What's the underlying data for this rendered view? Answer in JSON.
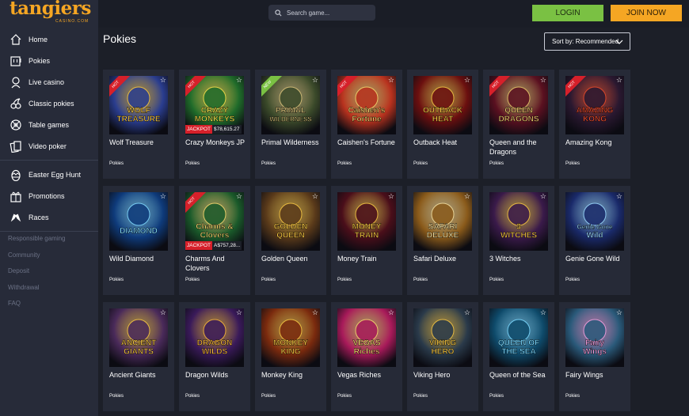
{
  "brand": {
    "logo_text": "tangiers",
    "logo_sub": "CASINO.COM"
  },
  "sidebar": {
    "items": [
      {
        "label": "Home",
        "icon": "home-icon"
      },
      {
        "label": "Pokies",
        "icon": "slot-machine-icon"
      },
      {
        "label": "Live casino",
        "icon": "dealer-icon"
      },
      {
        "label": "Classic pokies",
        "icon": "cherries-icon"
      },
      {
        "label": "Table games",
        "icon": "roulette-icon"
      },
      {
        "label": "Video poker",
        "icon": "cards-icon"
      },
      {
        "label": "Easter Egg Hunt",
        "icon": "egg-icon"
      },
      {
        "label": "Promotions",
        "icon": "gift-icon"
      },
      {
        "label": "Races",
        "icon": "race-flags-icon"
      }
    ],
    "footer": [
      "Responsible gaming",
      "Community",
      "Deposit",
      "Withdrawal",
      "FAQ"
    ]
  },
  "header": {
    "search_placeholder": "Search game...",
    "login": "LOGIN",
    "join": "JOIN NOW"
  },
  "main": {
    "title": "Pokies",
    "sort_label": "Sort by: Recommended"
  },
  "games": [
    {
      "name": "Wolf Treasure",
      "cat": "Pokies",
      "badge": "HOT",
      "art": "WOLF TREASURE",
      "bg": "#2a3d8f",
      "fg": "#f5c542"
    },
    {
      "name": "Crazy Monkeys JP",
      "cat": "Pokies",
      "badge": "HOT",
      "jackpot": "$78,615.27",
      "jp_label": "JACKPOT",
      "art": "CRAZY MONKEYS",
      "bg": "#1f6b2a",
      "fg": "#f5e04a"
    },
    {
      "name": "Primal Wilderness",
      "cat": "Pokies",
      "badge": "NEW",
      "art": "PRIMAL WILDERNESS",
      "bg": "#3b4a2a",
      "fg": "#d9c27a"
    },
    {
      "name": "Caishen's Fortune",
      "cat": "Pokies",
      "badge": "HOT",
      "art": "Caishen's Fortune",
      "bg": "#b8321e",
      "fg": "#f5d76e"
    },
    {
      "name": "Outback Heat",
      "cat": "Pokies",
      "badge": "",
      "art": "OUTBACK HEAT",
      "bg": "#6b0f0f",
      "fg": "#f5c542"
    },
    {
      "name": "Queen and the Dragons",
      "cat": "Pokies",
      "badge": "HOT",
      "art": "QUEEN DRAGONS",
      "bg": "#5a1020",
      "fg": "#e8c46a"
    },
    {
      "name": "Amazing Kong",
      "cat": "Pokies",
      "badge": "HOT",
      "art": "AMAZING KONG",
      "bg": "#2a1830",
      "fg": "#e84a2a"
    },
    {
      "name": "Wild Diamond",
      "cat": "Pokies",
      "badge": "",
      "art": "DIAMOND",
      "bg": "#0e3a7a",
      "fg": "#7fd8ff"
    },
    {
      "name": "Charms And Clovers",
      "cat": "Pokies",
      "badge": "HOT",
      "jackpot": "A$757,28...",
      "jp_label": "JACKPOT",
      "art": "Charms & Clovers",
      "bg": "#1a5a2a",
      "fg": "#f5d76e"
    },
    {
      "name": "Golden Queen",
      "cat": "Pokies",
      "badge": "",
      "art": "GOLDEN QUEEN",
      "bg": "#5a3a1a",
      "fg": "#f5c542"
    },
    {
      "name": "Money Train",
      "cat": "Pokies",
      "badge": "",
      "art": "MONEY TRAIN",
      "bg": "#4a0e1a",
      "fg": "#f5c542"
    },
    {
      "name": "Safari Deluxe",
      "cat": "Pokies",
      "badge": "",
      "art": "SAFARI DELUXE",
      "bg": "#8a5a1a",
      "fg": "#f5e0a0"
    },
    {
      "name": "3 Witches",
      "cat": "Pokies",
      "badge": "",
      "art": "3 WITCHES",
      "bg": "#3a1a4a",
      "fg": "#f5c542"
    },
    {
      "name": "Genie Gone Wild",
      "cat": "Pokies",
      "badge": "",
      "art": "Genie Gone Wild",
      "bg": "#1a2a6a",
      "fg": "#9ad8ff"
    },
    {
      "name": "Ancient Giants",
      "cat": "Pokies",
      "badge": "",
      "art": "ANCIENT GIANTS",
      "bg": "#4a2a5a",
      "fg": "#f5c542"
    },
    {
      "name": "Dragon Wilds",
      "cat": "Pokies",
      "badge": "",
      "art": "DRAGON WILDS",
      "bg": "#3a1a5a",
      "fg": "#f5b53a"
    },
    {
      "name": "Monkey King",
      "cat": "Pokies",
      "badge": "",
      "art": "MONKEY KING",
      "bg": "#7a2a0e",
      "fg": "#f5c542"
    },
    {
      "name": "Vegas Riches",
      "cat": "Pokies",
      "badge": "",
      "art": "VEGAS Riches",
      "bg": "#a81a5a",
      "fg": "#f5d76e"
    },
    {
      "name": "Viking Hero",
      "cat": "Pokies",
      "badge": "",
      "art": "VIKING HERO",
      "bg": "#2a3a4a",
      "fg": "#f5c542"
    },
    {
      "name": "Queen of the Sea",
      "cat": "Pokies",
      "badge": "",
      "art": "QUEEN OF THE SEA",
      "bg": "#0e4a6a",
      "fg": "#7ad8ff"
    },
    {
      "name": "Fairy Wings",
      "cat": "Pokies",
      "badge": "",
      "art": "Fairy Wings",
      "bg": "#2a5a7a",
      "fg": "#f5a0e0"
    }
  ]
}
